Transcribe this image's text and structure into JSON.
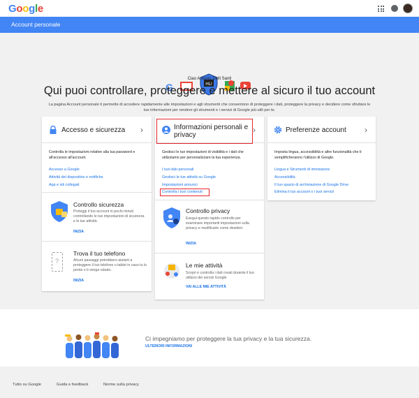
{
  "header": {
    "logo_letters": [
      "G",
      "o",
      "o",
      "g",
      "l",
      "e"
    ],
    "apps_icon": "apps-grid-icon",
    "notif_icon": "notifications-icon",
    "avatar_icon": "account-avatar"
  },
  "bluebar": {
    "title": "Account personale"
  },
  "hero": {
    "icons": [
      "google-g-icon",
      "gmail-icon",
      "security-shield-icon",
      "maps-icon",
      "youtube-icon"
    ],
    "greeting": "Ciao Antonio Delli Santi",
    "headline": "Qui puoi controllare, proteggere e mettere al sicuro il tuo account",
    "intro": "La pagina Account personale ti permette di accedere rapidamente alle impostazioni e agli strumenti che consentono di proteggere i dati, proteggere la privacy e decidere come sfruttare le tue informazioni per rendere gli strumenti e i servizi di Google più utili per te."
  },
  "cards": {
    "security": {
      "title": "Accesso e sicurezza",
      "icon": "lock-icon",
      "desc": "Controlla le impostazioni relative alla tua password e all'accesso all'account.",
      "links": [
        "Accesso a Google",
        "Attività del dispositivo e notifiche",
        "App e siti collegati"
      ],
      "sub1": {
        "title": "Controllo sicurezza",
        "text": "Proteggi il tuo account in pochi minuti controllando le tue impostazioni di sicurezza e le tue attività.",
        "link": "INIZIA",
        "icon": "security-checkup-shield-icon"
      },
      "sub2": {
        "title": "Trova il tuo telefono",
        "text": "Alcuni passaggi potrebbero aiutarti a proteggere il tuo telefono o tablet in caso tu lo perda o ti venga rubato.",
        "link": "INIZIA",
        "icon": "phone-icon"
      }
    },
    "personal": {
      "title_line1": "Informazioni personali e",
      "title_line2": "privacy",
      "icon": "person-icon",
      "desc": "Gestisci le tue impostazioni di visibilità e i dati che utilizziamo per personalizzare la tua esperienza.",
      "links": [
        "I tuoi dati personali",
        "Gestisci le tue attività su Google",
        "Impostazioni annunci",
        "Controlla i tuoi contenuti"
      ],
      "sub1": {
        "title": "Controllo privacy",
        "text": "Esegui questo rapido controllo per esaminare importanti impostazioni sulla privacy e modificarle come desideri.",
        "link": "INIZIA",
        "icon": "privacy-checkup-shield-icon"
      },
      "sub2": {
        "title": "Le mie attività",
        "text": "Scopri e controlla i dati creati durante il tuo utilizzo dei servizi Google",
        "link": "VAI ALLE MIE ATTIVITÀ",
        "icon": "my-activity-icon"
      }
    },
    "prefs": {
      "title": "Preferenze account",
      "icon": "gear-icon",
      "desc": "Imposta lingua, accessibilità e altre funzionalità che ti semplificheranno l'utilizzo di Google.",
      "links": [
        "Lingua e Strumenti di immissione",
        "Accessibilità",
        "Il tuo spazio di archiviazione di Google Drive",
        "Elimina il tuo account o i tuoi servizi"
      ]
    }
  },
  "chevron": "›",
  "privacy": {
    "statement": "Ci impegniamo per proteggere la tua privacy e la tua sicurezza.",
    "link": "ULTERIORI INFORMAZIONI",
    "illustration": "people-illustration"
  },
  "footer": {
    "links": [
      "Tutto su Google",
      "Guida e feedback",
      "Norme sulla privacy"
    ]
  },
  "colors": {
    "google_blue": "#4285f4",
    "link_blue": "#1a73e8",
    "highlight_red": "#e5262c",
    "background": "#f1f1f1"
  }
}
